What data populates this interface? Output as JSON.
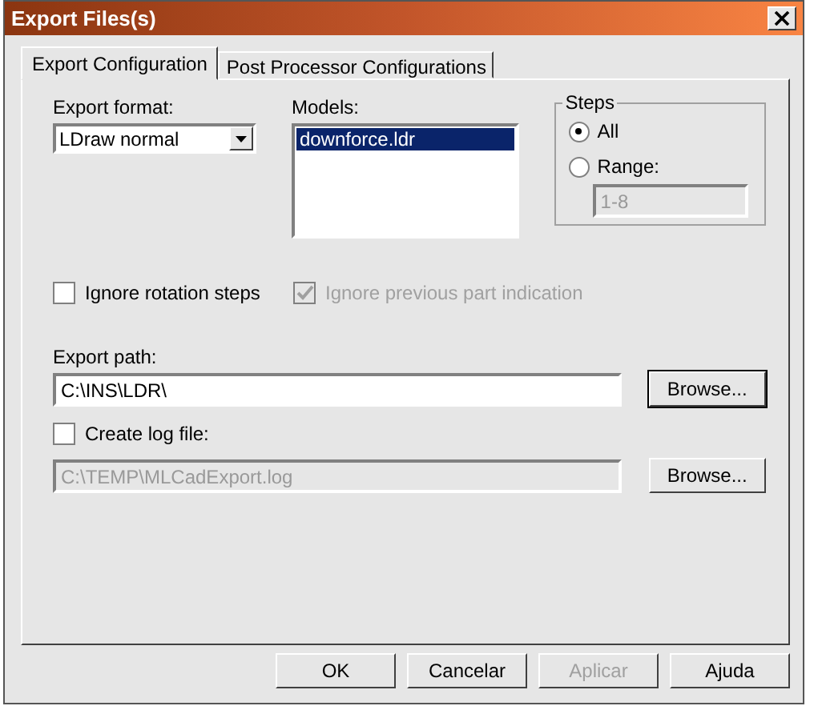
{
  "window": {
    "title": "Export Files(s)"
  },
  "tabs": [
    {
      "label": "Export Configuration",
      "selected": true
    },
    {
      "label": "Post Processor Configurations",
      "selected": false
    }
  ],
  "export_format": {
    "label": "Export format:",
    "value": "LDraw normal"
  },
  "models": {
    "label": "Models:",
    "items": [
      {
        "name": "downforce.ldr",
        "selected": true
      }
    ]
  },
  "steps": {
    "title": "Steps",
    "options": [
      {
        "label": "All",
        "selected": true
      },
      {
        "label": "Range:",
        "selected": false
      }
    ],
    "range_field": {
      "value": "1-8",
      "disabled": true
    }
  },
  "options": [
    {
      "label": "Ignore rotation steps",
      "checked": false,
      "disabled": false
    },
    {
      "label": "Ignore previous part indication",
      "checked": true,
      "disabled": true
    }
  ],
  "export_path": {
    "label": "Export path:",
    "value": "C:\\INS\\LDR\\",
    "browse": "Browse...",
    "disabled": false
  },
  "log_file": {
    "label": "Create log file:",
    "checked": false,
    "value": "C:\\TEMP\\MLCadExport.log",
    "browse": "Browse...",
    "disabled": true
  },
  "buttons": [
    {
      "label": "OK",
      "disabled": false
    },
    {
      "label": "Cancelar",
      "disabled": false
    },
    {
      "label": "Aplicar",
      "disabled": true
    },
    {
      "label": "Ajuda",
      "disabled": false
    }
  ]
}
